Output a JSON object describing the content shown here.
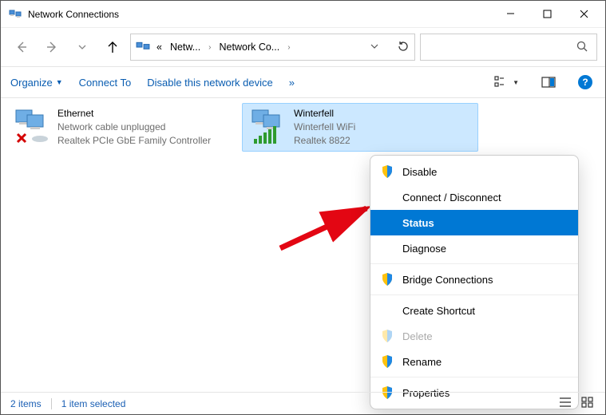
{
  "window": {
    "title": "Network Connections"
  },
  "breadcrumb": {
    "prefix": "«",
    "seg1": "Netw...",
    "seg2": "Network Co..."
  },
  "cmdbar": {
    "organize": "Organize",
    "connect_to": "Connect To",
    "disable_device": "Disable this network device",
    "overflow": "»"
  },
  "adapters": [
    {
      "name": "Ethernet",
      "status": "Network cable unplugged",
      "device": "Realtek PCIe GbE Family Controller",
      "selected": false,
      "unplugged": true
    },
    {
      "name": "Winterfell",
      "status": "Winterfell WiFi",
      "device": "Realtek 8822",
      "selected": true,
      "unplugged": false
    }
  ],
  "context_menu": [
    {
      "label": "Disable",
      "shield": true
    },
    {
      "label": "Connect / Disconnect"
    },
    {
      "label": "Status",
      "selected": true
    },
    {
      "label": "Diagnose"
    },
    {
      "sep": true
    },
    {
      "label": "Bridge Connections",
      "shield": true
    },
    {
      "sep": true
    },
    {
      "label": "Create Shortcut"
    },
    {
      "label": "Delete",
      "shield": true,
      "disabled": true
    },
    {
      "label": "Rename",
      "shield": true
    },
    {
      "sep": true
    },
    {
      "label": "Properties",
      "shield": true
    }
  ],
  "statusbar": {
    "count": "2 items",
    "selected": "1 item selected"
  }
}
